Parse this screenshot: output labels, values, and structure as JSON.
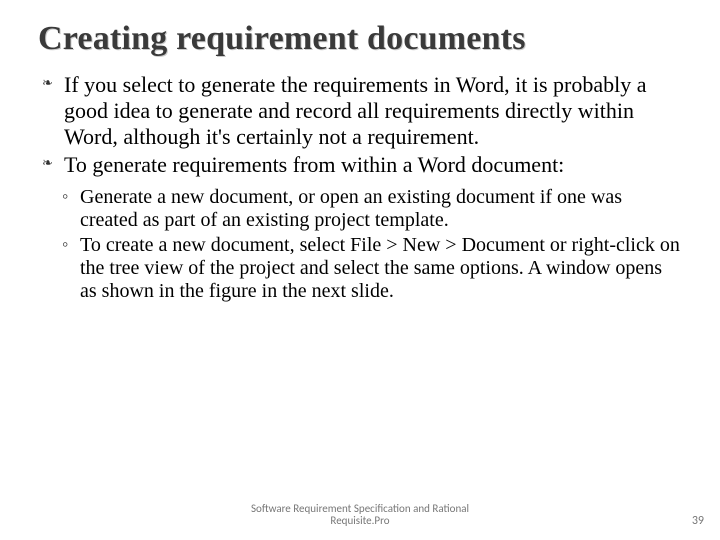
{
  "title": "Creating requirement documents",
  "bullets": [
    "If you select to generate the requirements in Word, it is probably a good idea to generate and record all requirements directly within Word, although it's certainly not a requirement.",
    "To generate requirements from within a Word document:"
  ],
  "subbullets": [
    "Generate a new document, or open an existing document if one was created as part of an existing project template.",
    "To create a new document, select File > New > Document or right-click on the tree view of the project and select the same options. A window opens as shown in the figure in the next slide."
  ],
  "footer": {
    "text": "Software Requirement Specification and Rational\nRequisite.Pro",
    "page": "39"
  }
}
